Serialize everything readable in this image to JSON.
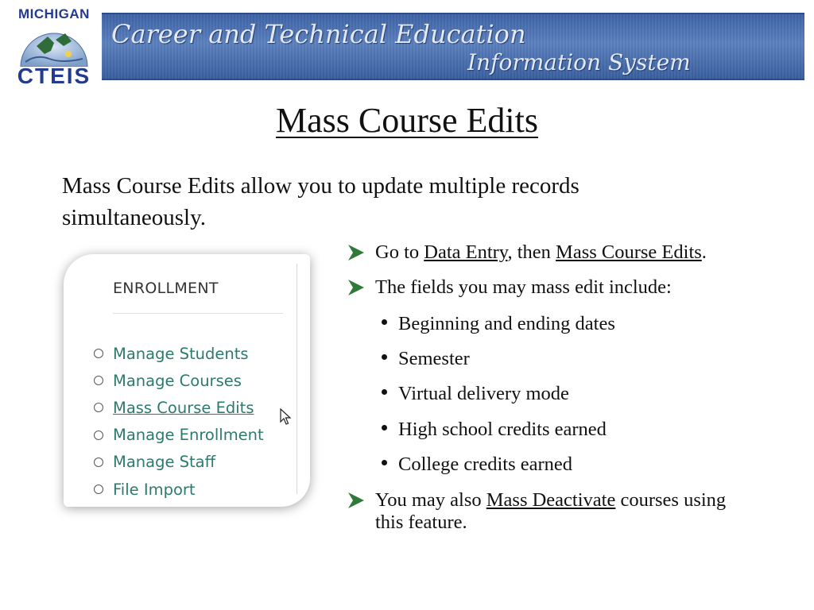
{
  "header": {
    "logo_top": "MICHIGAN",
    "logo_bottom": "CTEIS",
    "banner_line1": "Career and Technical Education",
    "banner_line2": "Information System"
  },
  "title": "Mass Course Edits",
  "intro": "Mass Course Edits allow you to update multiple records simultaneously.",
  "menu": {
    "heading": "ENROLLMENT",
    "items": [
      {
        "label": "Manage Students"
      },
      {
        "label": "Manage Courses"
      },
      {
        "label": "Mass Course Edits"
      },
      {
        "label": "Manage Enrollment"
      },
      {
        "label": "Manage Staff"
      },
      {
        "label": "File Import"
      }
    ]
  },
  "bullets": {
    "b1_pre": "Go to ",
    "b1_link1": "Data Entry",
    "b1_mid": ", then ",
    "b1_link2": "Mass Course Edits",
    "b1_end": ".",
    "b2": "The fields you may mass edit include:",
    "subs": [
      "Beginning and ending dates",
      "Semester",
      "Virtual delivery mode",
      "High school credits earned",
      "College credits earned"
    ],
    "b3_pre": "You may also ",
    "b3_link": "Mass Deactivate",
    "b3_post": " courses using",
    "b3_line2": "this feature."
  },
  "colors": {
    "banner": "#4a6fb0",
    "logo_text": "#233a8e",
    "menu_link": "#2c7a6e",
    "arrow": "#2f7a3a"
  }
}
